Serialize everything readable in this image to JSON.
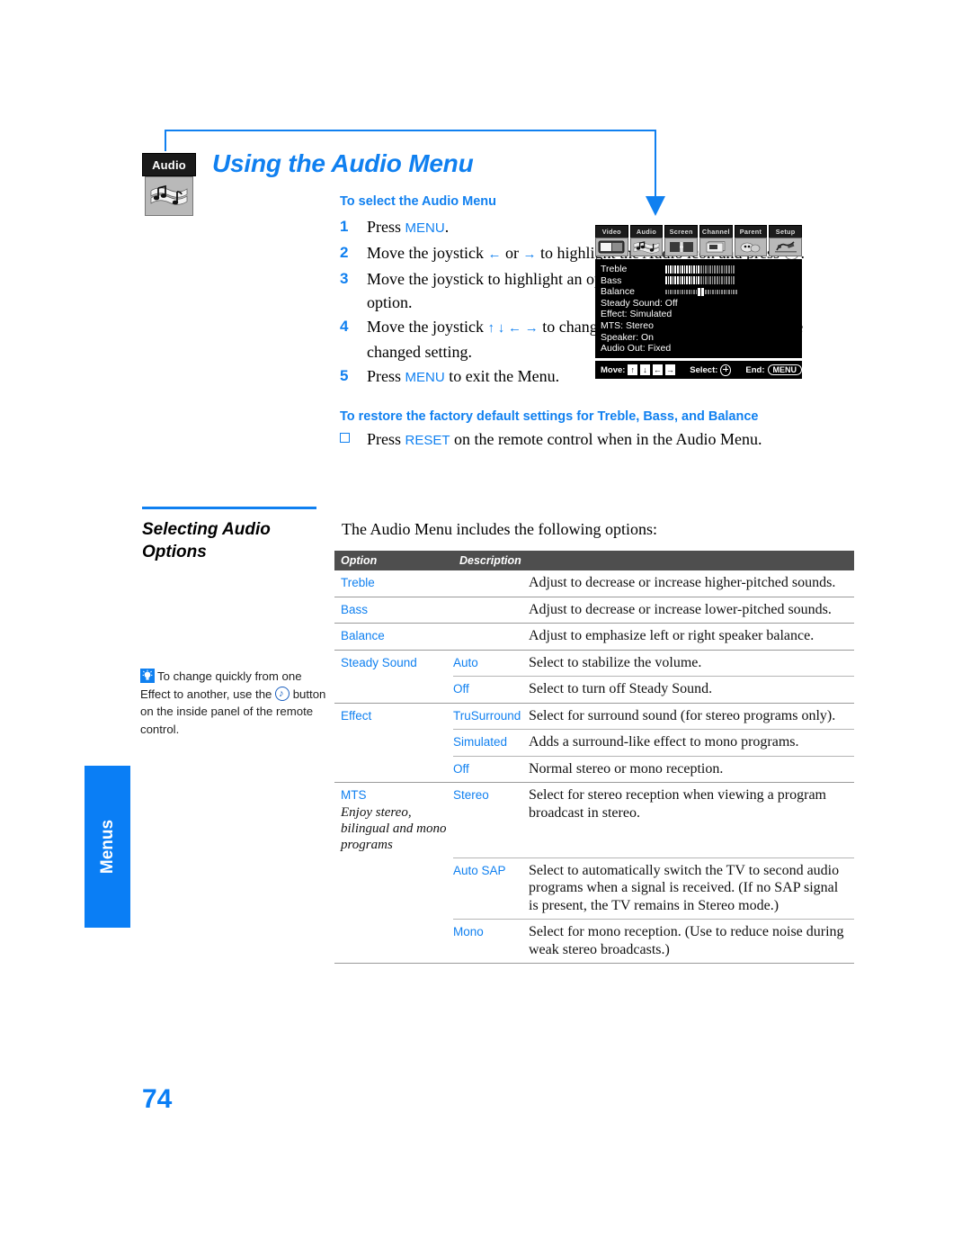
{
  "page": {
    "number": "74",
    "side_tab": "Menus"
  },
  "header": {
    "badge_label": "Audio",
    "badge_icon": "audio-note-icon",
    "title": "Using the Audio Menu"
  },
  "instructions": {
    "heading": "To select the Audio Menu",
    "steps": [
      {
        "num": "1",
        "parts": [
          "Press ",
          "MENU",
          "."
        ]
      },
      {
        "num": "2",
        "text_a": "Move the joystick ",
        "left_arrow": "←",
        "text_b": " or ",
        "right_arrow": "→",
        "text_c": " to highlight the Audio icon and press ",
        "text_d": "."
      },
      {
        "num": "3",
        "text_a": "Move the joystick to highlight an option. Press ",
        "text_b": " to select an option."
      },
      {
        "num": "4",
        "text_a": "Move the joystick ",
        "arrows": "↑ ↓ ← →",
        "text_b": " to change settings. Press ",
        "text_c": " to select the changed setting."
      },
      {
        "num": "5",
        "parts": [
          "Press ",
          "MENU",
          " to exit the Menu."
        ]
      }
    ],
    "restore_heading": "To restore the factory default settings for Treble, Bass, and Balance",
    "restore_text_a": "Press ",
    "restore_keyword": "RESET",
    "restore_text_b": " on the remote control when in the Audio Menu."
  },
  "tv_menu": {
    "tabs": [
      {
        "label": "Video",
        "icon": "video-screen-icon"
      },
      {
        "label": "Audio",
        "icon": "audio-note-icon"
      },
      {
        "label": "Screen",
        "icon": "screen-size-icon"
      },
      {
        "label": "Channel",
        "icon": "channel-list-icon"
      },
      {
        "label": "Parent",
        "icon": "parent-lock-icon"
      },
      {
        "label": "Setup",
        "icon": "setup-tools-icon"
      }
    ],
    "rows": [
      {
        "label": "Treble",
        "type": "bar",
        "fill": 0.5
      },
      {
        "label": "Bass",
        "type": "bar",
        "fill": 0.5
      },
      {
        "label": "Balance",
        "type": "balance",
        "fill": 0.5
      },
      {
        "label": "Steady Sound: Off",
        "type": "text"
      },
      {
        "label": "Effect: Simulated",
        "type": "text"
      },
      {
        "label": "MTS: Stereo",
        "type": "text"
      },
      {
        "label": "Speaker: On",
        "type": "text"
      },
      {
        "label": "Audio Out: Fixed",
        "type": "text"
      }
    ],
    "footer": {
      "move_label": "Move:",
      "select_label": "Select:",
      "end_label": "End:",
      "end_key": "MENU",
      "keys": [
        "↑",
        "↓",
        "←",
        "→"
      ]
    }
  },
  "left_column": {
    "section_title": "Selecting Audio Options",
    "tip_icon": "lightbulb-tip-icon",
    "tip_text_a": "To change quickly from one Effect to another, use the ",
    "tip_icon_inline": "sound-effect-button-icon",
    "tip_text_b": " button on the inside panel of the remote control."
  },
  "table": {
    "intro": "The Audio Menu includes the following options:",
    "headers": {
      "option": "Option",
      "description": "Description"
    },
    "rows": [
      {
        "option": "Treble",
        "sub": "",
        "desc": "Adjust to decrease or increase higher-pitched sounds.",
        "rule": "full"
      },
      {
        "option": "Bass",
        "sub": "",
        "desc": "Adjust to decrease or increase lower-pitched sounds.",
        "rule": "full"
      },
      {
        "option": "Balance",
        "sub": "",
        "desc": "Adjust to emphasize left or right speaker balance.",
        "rule": "full"
      },
      {
        "option": "Steady Sound",
        "sub": "Auto",
        "desc": "Select to stabilize the volume.",
        "rule": "full"
      },
      {
        "option": "",
        "sub": "Off",
        "desc": "Select to turn off Steady Sound.",
        "rule": "sub"
      },
      {
        "option": "Effect",
        "sub": "TruSurround",
        "desc": "Select for surround sound (for stereo programs only).",
        "rule": "full"
      },
      {
        "option": "",
        "sub": "Simulated",
        "desc": "Adds a surround-like effect to mono programs.",
        "rule": "sub"
      },
      {
        "option": "",
        "sub": "Off",
        "desc": "Normal stereo or mono reception.",
        "rule": "sub"
      },
      {
        "option": "MTS",
        "option_note": "Enjoy stereo, bilingual and mono programs",
        "sub": "Stereo",
        "desc": "Select for stereo reception when viewing a program broadcast in stereo.",
        "rule": "full"
      },
      {
        "option": "",
        "sub": "Auto SAP",
        "desc": "Select to automatically switch the TV to second audio programs when a signal is received. (If no SAP signal is present, the TV remains in Stereo mode.)",
        "rule": "sub"
      },
      {
        "option": "",
        "sub": "Mono",
        "desc": "Select for mono reception. (Use to reduce noise during weak stereo broadcasts.)",
        "rule": "sub"
      }
    ]
  },
  "colors": {
    "accent_blue": "#1080F0",
    "tab_blue": "#0A7EF5",
    "table_header_gray": "#4e4e4e"
  }
}
